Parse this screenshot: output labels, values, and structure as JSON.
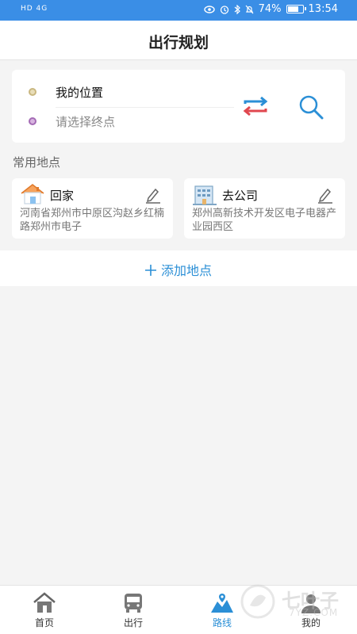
{
  "status_bar": {
    "network": "HD 4G",
    "battery": "74%",
    "battery_level": 0.74,
    "time": "13:54"
  },
  "header": {
    "title": "出行规划"
  },
  "route": {
    "from_label": "我的位置",
    "to_placeholder": "请选择终点"
  },
  "common_places": {
    "section_label": "常用地点",
    "items": [
      {
        "name": "回家",
        "address": "河南省郑州市中原区沟赵乡红楠路郑州市电子",
        "icon": "house-icon"
      },
      {
        "name": "去公司",
        "address": "郑州高新技术开发区电子电器产业园西区",
        "icon": "office-building-icon"
      }
    ],
    "add_label": "添加地点"
  },
  "tabs": [
    {
      "label": "首页",
      "icon": "home-icon",
      "active": false
    },
    {
      "label": "出行",
      "icon": "bus-icon",
      "active": false
    },
    {
      "label": "路线",
      "icon": "route-map-icon",
      "active": true
    },
    {
      "label": "我的",
      "icon": "profile-icon",
      "active": false
    }
  ],
  "watermark": {
    "text": "七叶子",
    "sub": "7YZ.COM"
  },
  "colors": {
    "status_bar": "#3a8ee6",
    "accent": "#2b8fd6",
    "swap_red": "#e0474f",
    "swap_blue": "#2b8fd6"
  }
}
